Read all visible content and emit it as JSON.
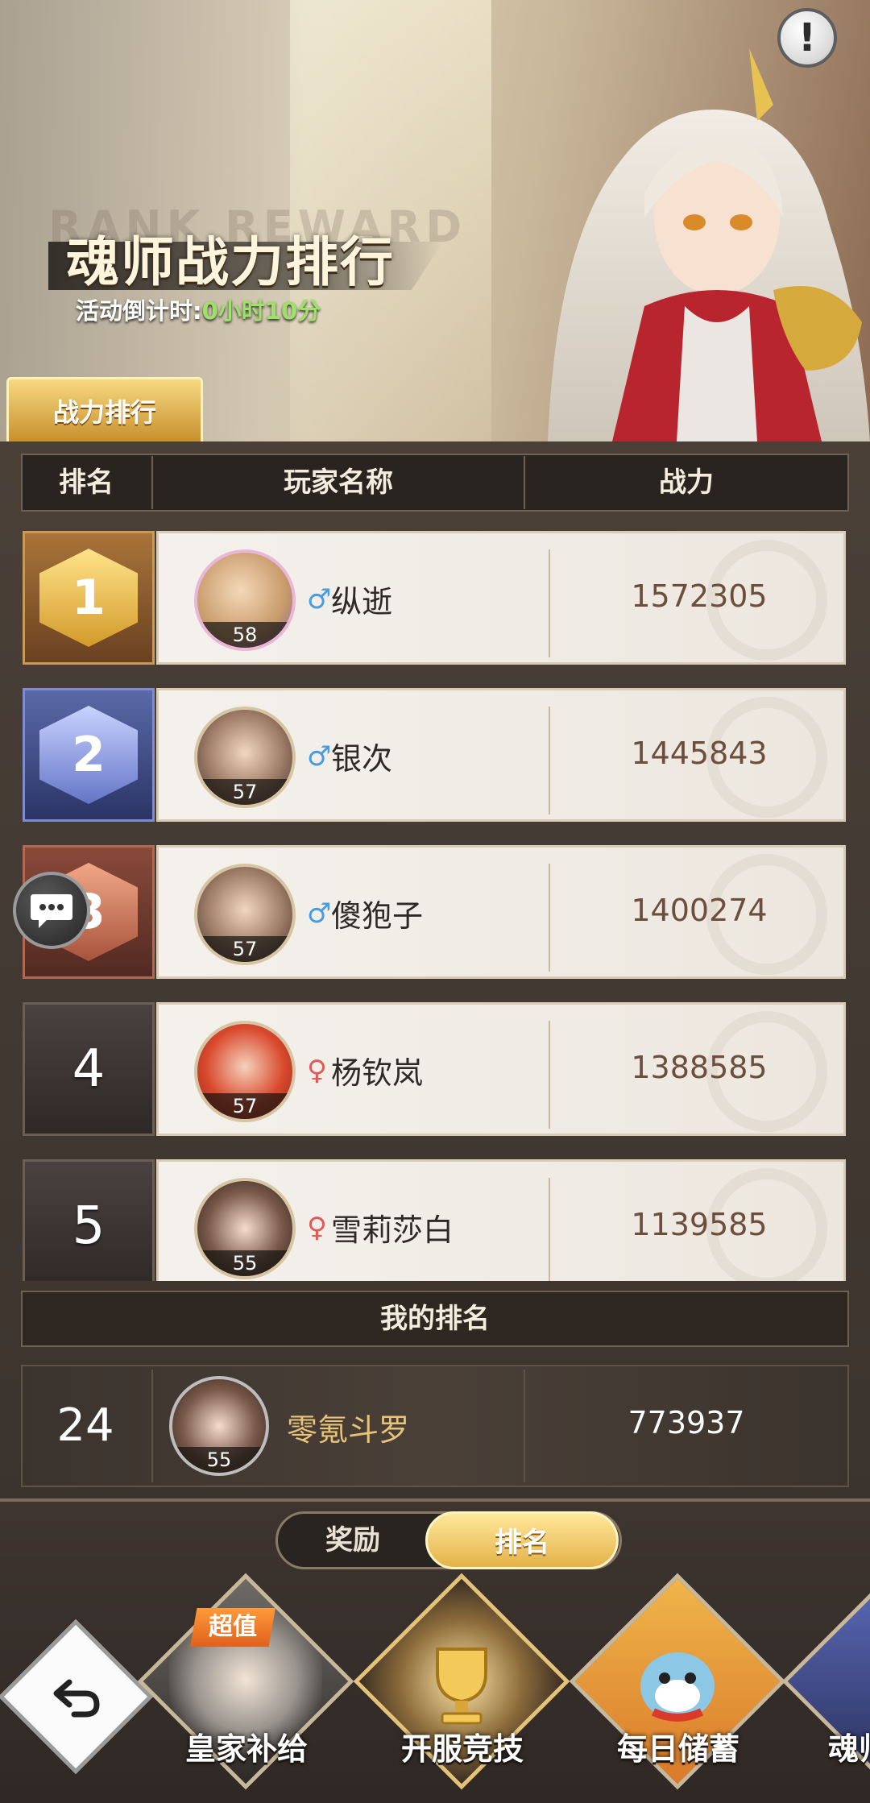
{
  "banner": {
    "title": "魂师战力排行",
    "countdown_label": "活动倒计时:",
    "countdown_value": "0小时10分",
    "tab_label": "战力排行",
    "info_label": "!",
    "ghost_text": "RANK REWARD"
  },
  "table": {
    "headers": {
      "rank": "排名",
      "player": "玩家名称",
      "power": "战力"
    },
    "rows": [
      {
        "rank": "1",
        "level": "58",
        "gender": "♂",
        "name": "纵逝",
        "power": "1572305"
      },
      {
        "rank": "2",
        "level": "57",
        "gender": "♂",
        "name": "银次",
        "power": "1445843"
      },
      {
        "rank": "3",
        "level": "57",
        "gender": "♂",
        "name": "傻狍子",
        "power": "1400274"
      },
      {
        "rank": "4",
        "level": "57",
        "gender": "♀",
        "name": "杨钦岚",
        "power": "1388585"
      },
      {
        "rank": "5",
        "level": "55",
        "gender": "♀",
        "name": "雪莉莎白",
        "power": "1139585"
      }
    ]
  },
  "my_rank": {
    "header": "我的排名",
    "rank": "24",
    "level": "55",
    "name": "零氪斗罗",
    "power": "773937"
  },
  "toggle": {
    "reward": "奖励",
    "rank": "排名"
  },
  "nav": {
    "badge": "超值",
    "items": [
      {
        "label": "皇家补给"
      },
      {
        "label": "开服竞技"
      },
      {
        "label": "每日储蓄"
      },
      {
        "label": "魂师"
      }
    ]
  },
  "colors": {
    "gold": "#e4b24a",
    "male": "#4a9be0",
    "female": "#e05a5a",
    "countdown": "#9ee06a"
  }
}
